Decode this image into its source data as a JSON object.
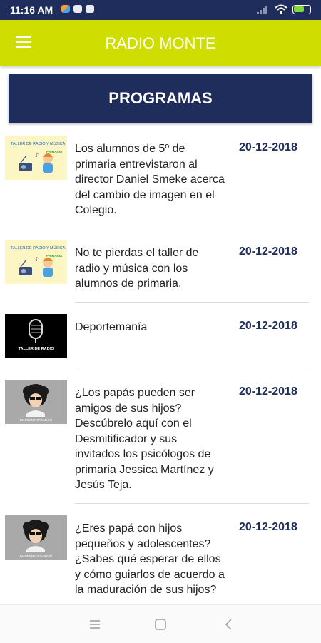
{
  "status_bar": {
    "time": "11:16 AM",
    "notifications": [
      "photos-icon",
      "chat-icon",
      "chat-icon"
    ],
    "battery_percent": 70,
    "signal": "wifi-icon"
  },
  "app_bar": {
    "title": "RADIO MONTE",
    "color": "#cfde00",
    "menu_icon": "hamburger-icon"
  },
  "banner": {
    "label": "PROGRAMAS",
    "color": "#1f2d5c"
  },
  "programs": [
    {
      "thumbnail": "radio-music-workshop-thumbnail",
      "thumbnail_caption": "TALLER DE RADIO Y MÚSICA",
      "thumbnail_tag": "PRIMARIA",
      "text": "Los alumnos de 5º de primaria entrevistaron al director Daniel Smeke acerca del cambio de imagen en el Colegio.",
      "date": "20-12-2018"
    },
    {
      "thumbnail": "radio-music-workshop-thumbnail",
      "thumbnail_caption": "TALLER DE RADIO Y MÚSICA",
      "thumbnail_tag": "PRIMARIA",
      "text": "No te pierdas el taller de radio y música con los alumnos de primaria.",
      "date": "20-12-2018"
    },
    {
      "thumbnail": "radio-workshop-microphone-thumbnail",
      "thumbnail_caption": "TALLER DE RADIO",
      "thumbnail_tag": "",
      "text": "Deportemanía",
      "date": "20-12-2018"
    },
    {
      "thumbnail": "desmitificador-thumbnail",
      "thumbnail_caption": "EL DESMITIFICADOR",
      "thumbnail_tag": "",
      "text": "¿Los papás pueden ser amigos de sus hijos? Descúbrelo aquí con el Desmitificador y sus invitados los psicólogos de primaria Jessica Martínez y Jesús Teja.",
      "date": "20-12-2018"
    },
    {
      "thumbnail": "desmitificador-thumbnail",
      "thumbnail_caption": "EL DESMITIFICADOR",
      "thumbnail_tag": "",
      "text": "¿Eres papá con hijos pequeños y adolescentes? ¿Sabes qué esperar de ellos y cómo guiarlos de acuerdo a la maduración de sus hijos?",
      "date": "20-12-2018"
    }
  ],
  "nav_bar": {
    "buttons": [
      "recents-icon",
      "home-icon",
      "back-icon"
    ]
  }
}
